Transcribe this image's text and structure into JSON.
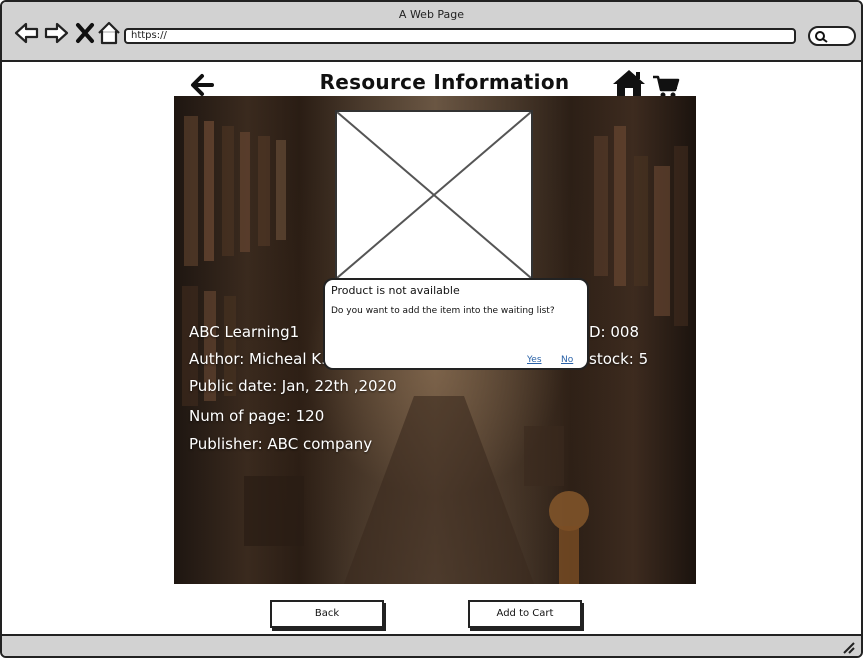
{
  "window": {
    "title": "A Web Page"
  },
  "browser": {
    "url": "https://"
  },
  "page": {
    "title": "Resource Information"
  },
  "resource": {
    "name": "ABC Learning1",
    "author": "Author: Micheal K.",
    "public_date": "Public date: Jan, 22th ,2020",
    "num_pages": "Num of page: 120",
    "publisher": "Publisher: ABC company",
    "id_partial": "D: 008",
    "stock_partial": "stock: 5"
  },
  "dialog": {
    "title": "Product is not available",
    "message": "Do you want to add the item into the waiting list?",
    "yes_label": "Yes",
    "no_label": "No"
  },
  "buttons": {
    "back_label": "Back",
    "add_to_cart_label": "Add to Cart"
  },
  "colors": {
    "chrome": "#d2d2d2",
    "link": "#2a62a8",
    "outline": "#222222"
  },
  "icons": [
    "back-arrow-icon",
    "forward-arrow-icon",
    "close-icon",
    "home-icon",
    "search-icon",
    "cart-icon",
    "resize-grip-icon"
  ]
}
